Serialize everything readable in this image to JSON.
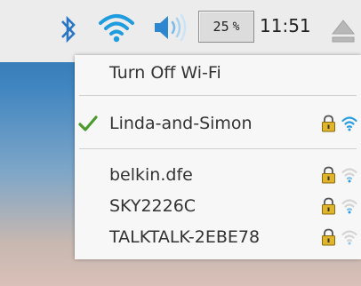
{
  "taskbar": {
    "cpu_value": "25",
    "cpu_unit": "%",
    "clock": "11:51"
  },
  "wifi_menu": {
    "turn_off_label": "Turn Off Wi-Fi",
    "networks": [
      {
        "ssid": "Linda-and-Simon",
        "connected": true,
        "secured": true,
        "signal": "strong"
      },
      {
        "ssid": "belkin.dfe",
        "connected": false,
        "secured": true,
        "signal": "weak"
      },
      {
        "ssid": "SKY2226C",
        "connected": false,
        "secured": true,
        "signal": "weak"
      },
      {
        "ssid": "TALKTALK-2EBE78",
        "connected": false,
        "secured": true,
        "signal": "weak"
      }
    ]
  },
  "colors": {
    "accent_blue": "#2a8fd6",
    "check_green": "#4a9a2e",
    "lock_gold": "#d9b12a"
  }
}
